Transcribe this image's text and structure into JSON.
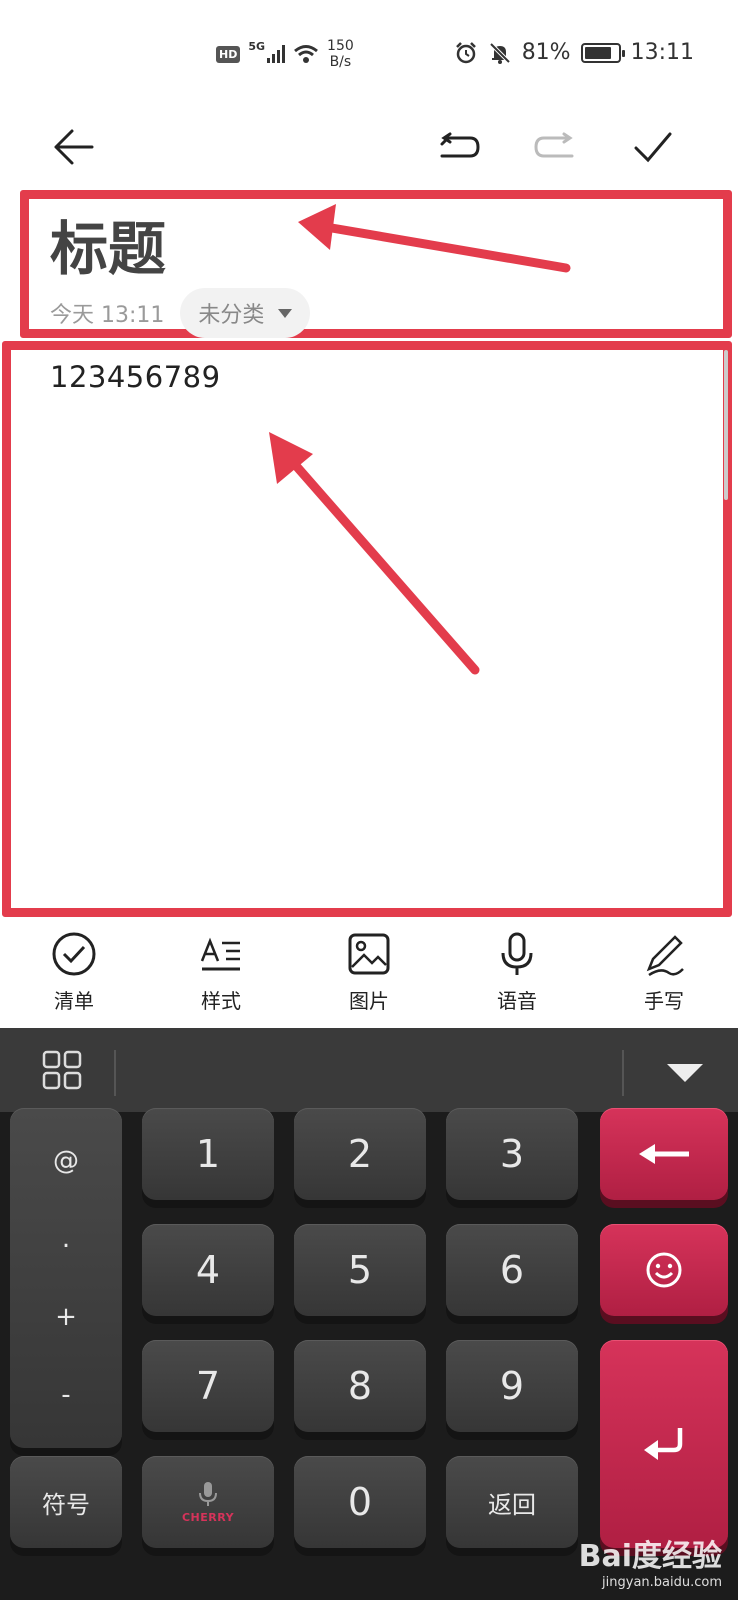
{
  "status_bar": {
    "hd": "HD",
    "network": "5G",
    "speed_value": "150",
    "speed_unit": "B/s",
    "battery": "81%",
    "battery_level": 0.81,
    "time": "13:11"
  },
  "toolbar": {
    "back_icon": "arrow-left-icon",
    "undo_icon": "undo-icon",
    "redo_icon": "redo-icon",
    "done_icon": "checkmark-icon"
  },
  "note": {
    "title": "标题",
    "date": "今天 13:11",
    "category": "未分类",
    "body": "123456789"
  },
  "tools": [
    {
      "label": "清单",
      "icon": "checklist-icon"
    },
    {
      "label": "样式",
      "icon": "text-style-icon"
    },
    {
      "label": "图片",
      "icon": "image-icon"
    },
    {
      "label": "语音",
      "icon": "microphone-icon"
    },
    {
      "label": "手写",
      "icon": "pen-icon"
    }
  ],
  "keyboard": {
    "symbols": [
      "@",
      ".",
      "+",
      "-"
    ],
    "digits": [
      "1",
      "2",
      "3",
      "4",
      "5",
      "6",
      "7",
      "8",
      "9",
      "0"
    ],
    "symbol_key": "符号",
    "brand": "CHERRY",
    "back_key": "返回",
    "colors": {
      "accent": "#d6335a",
      "key": "#424242",
      "background": "#1c1c1c"
    }
  },
  "annotation_color": "#e33c4c",
  "watermark": {
    "brand": "Bai度经验",
    "url": "jingyan.baidu.com"
  }
}
